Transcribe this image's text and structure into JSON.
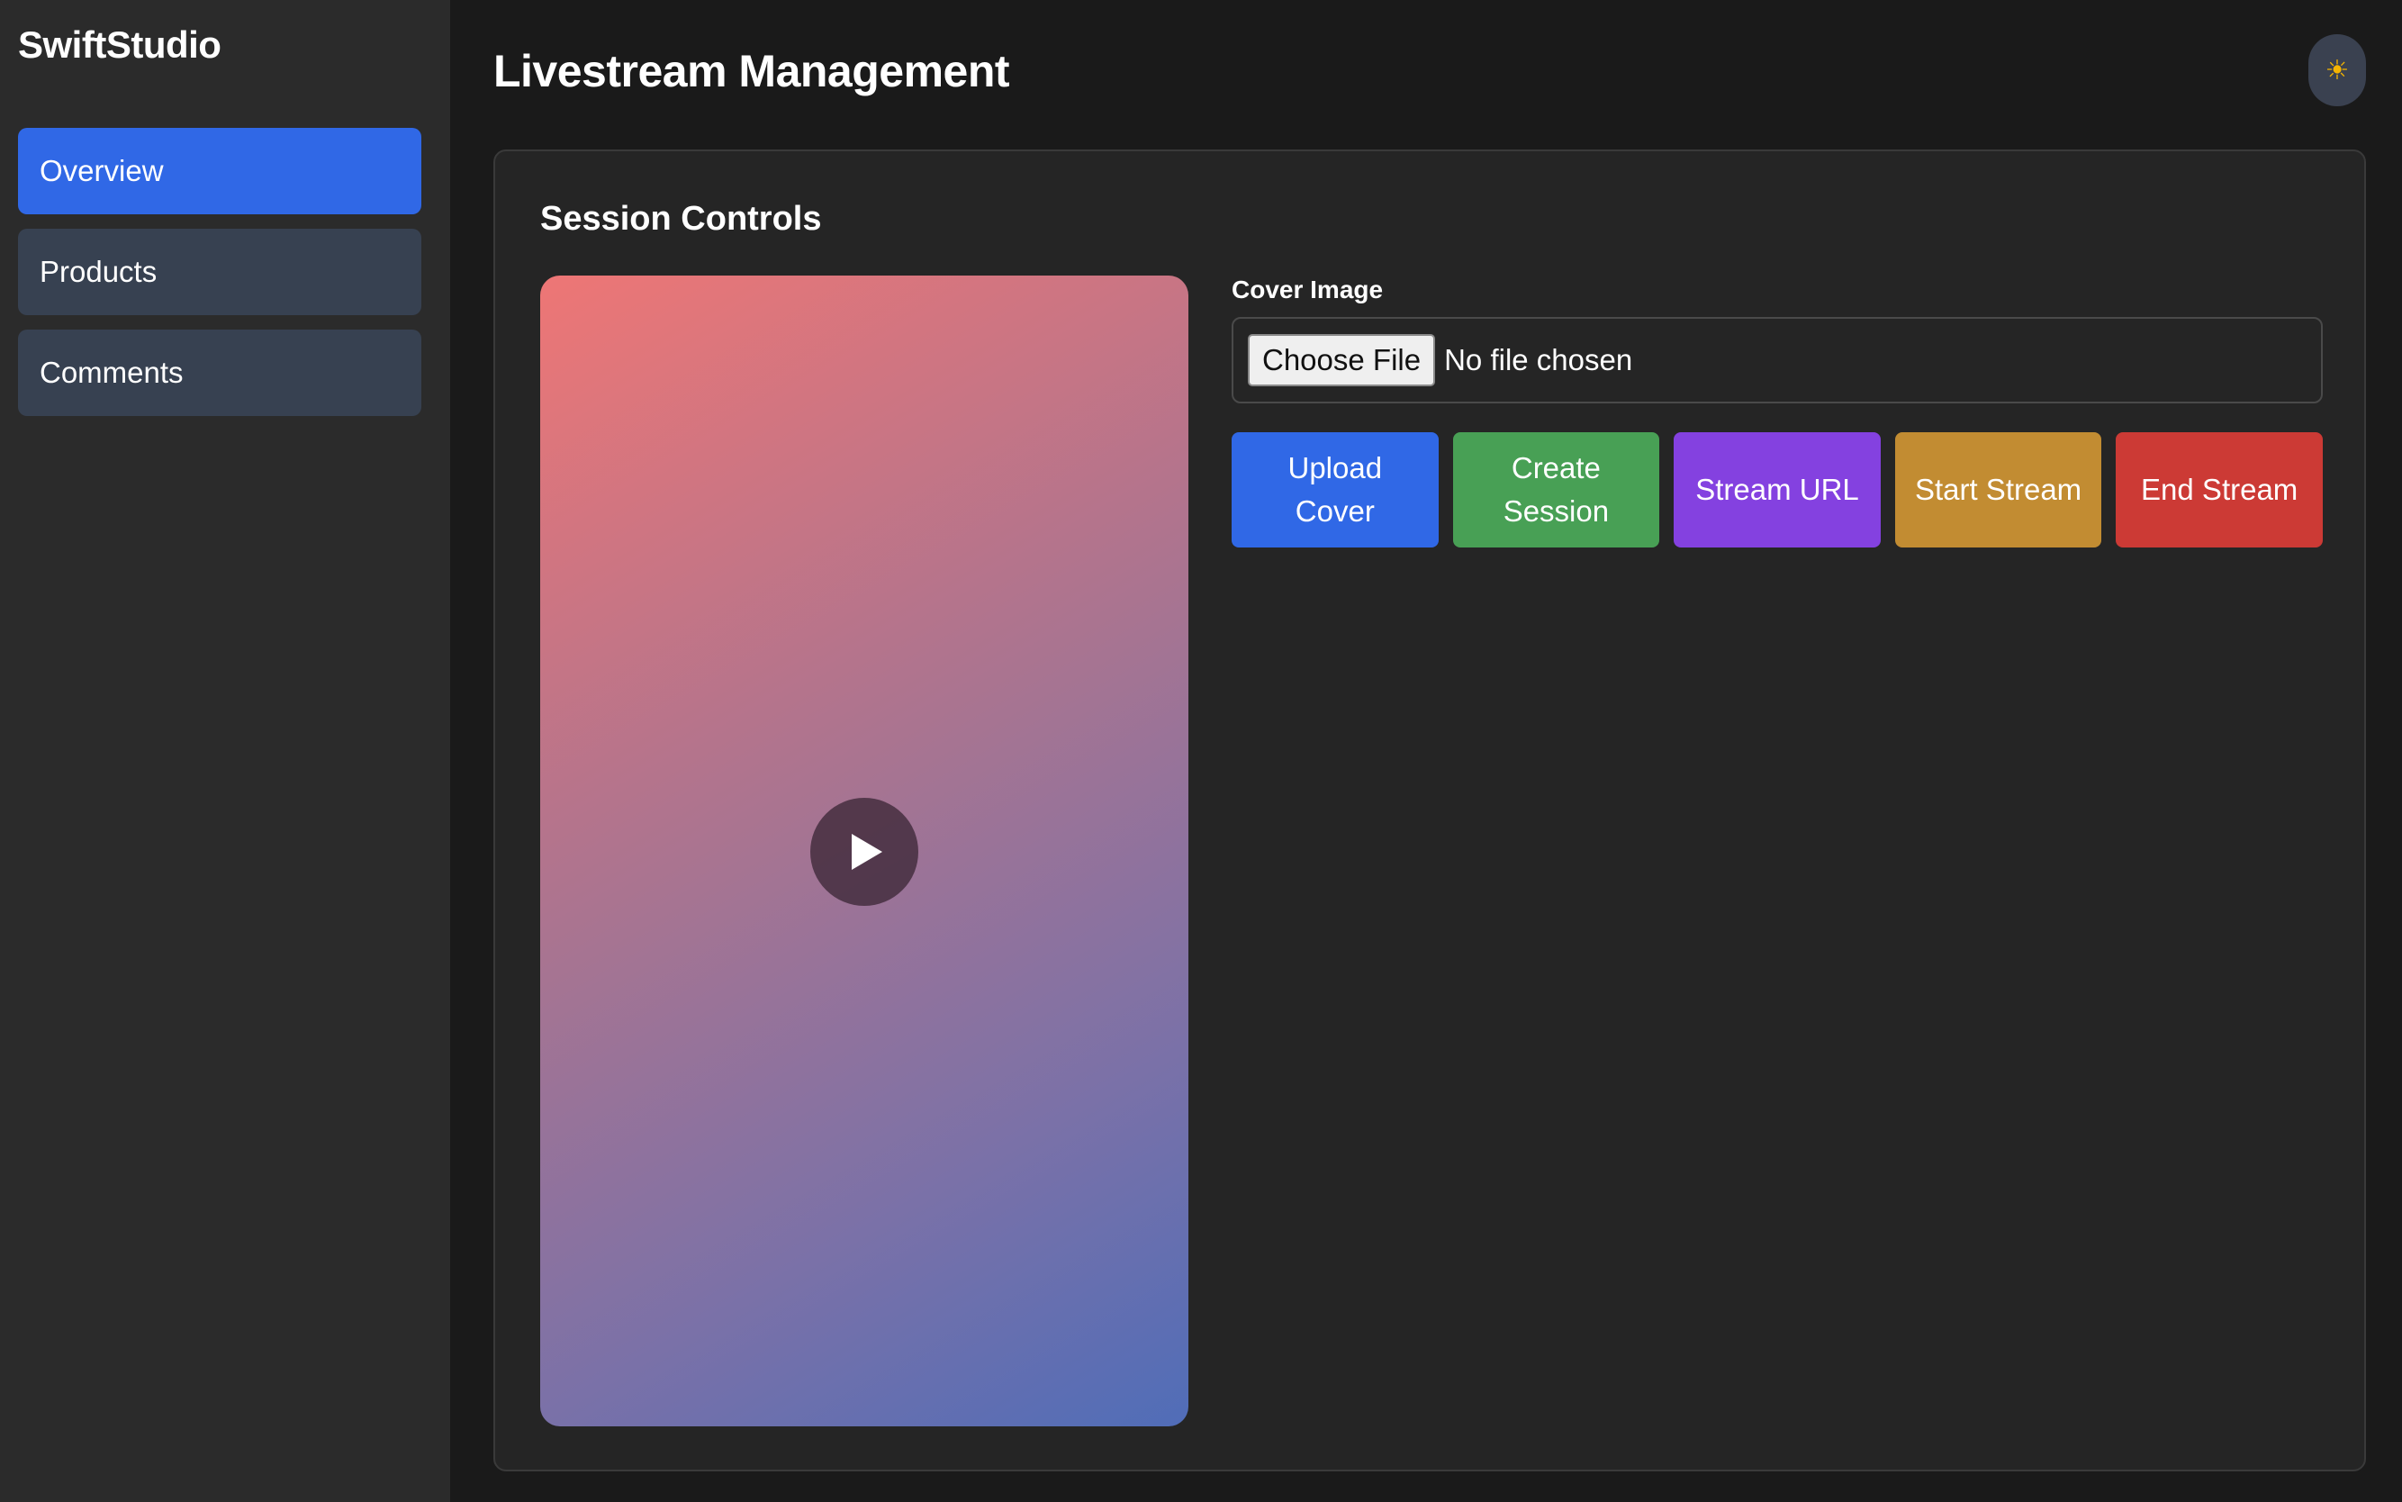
{
  "brand": "SwiftStudio",
  "sidebar": {
    "items": [
      {
        "label": "Overview",
        "active": true
      },
      {
        "label": "Products",
        "active": false
      },
      {
        "label": "Comments",
        "active": false
      }
    ]
  },
  "header": {
    "title": "Livestream Management",
    "theme_icon": "sun-icon"
  },
  "panel": {
    "title": "Session Controls",
    "cover_label": "Cover Image",
    "file_button": "Choose File",
    "file_status": "No file chosen",
    "actions": [
      {
        "label": "Upload Cover",
        "color": "#3068e6"
      },
      {
        "label": "Create Session",
        "color": "#48a055"
      },
      {
        "label": "Stream URL",
        "color": "#8441e0"
      },
      {
        "label": "Start Stream",
        "color": "#c28c32"
      },
      {
        "label": "End Stream",
        "color": "#cc3a35"
      }
    ]
  },
  "colors": {
    "accent": "#3068e6",
    "sidebar_bg": "#2b2b2b",
    "page_bg": "#1a1a1a",
    "panel_bg": "#252525"
  }
}
